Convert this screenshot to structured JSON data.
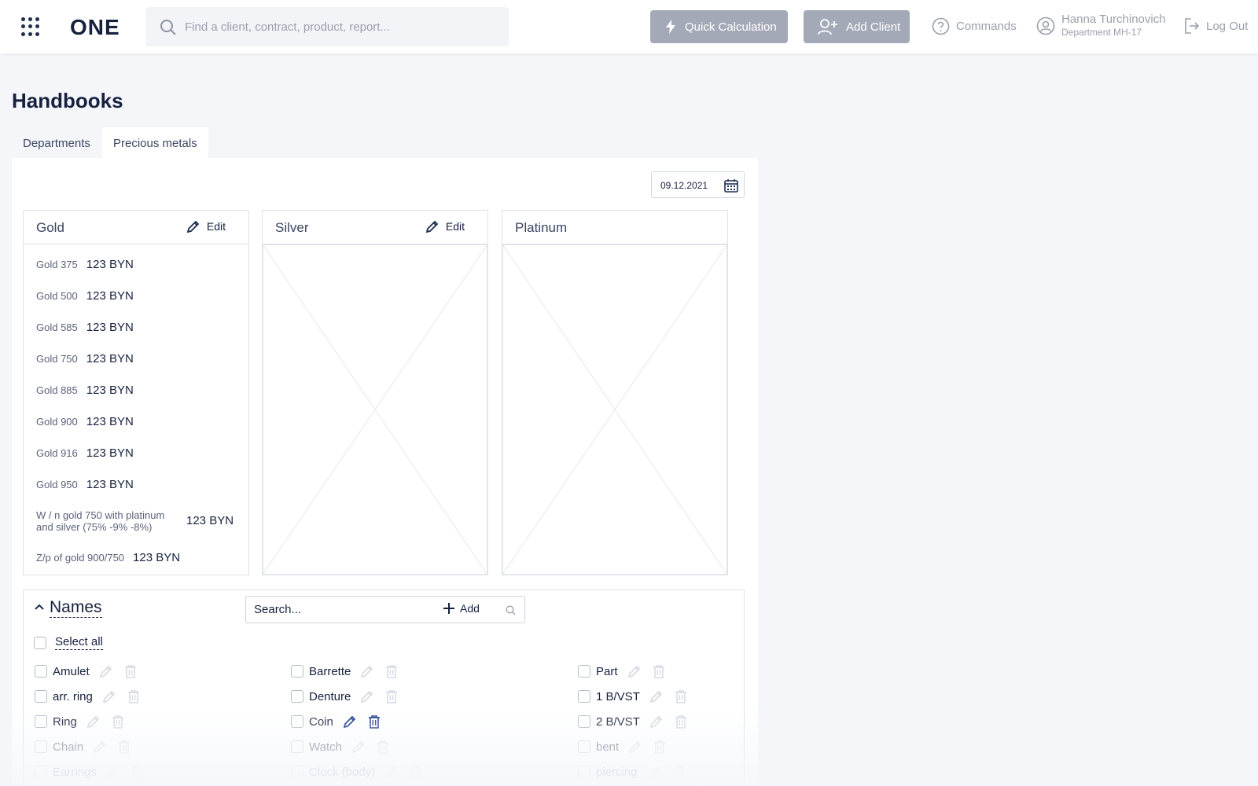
{
  "app": {
    "logo": "ONE"
  },
  "header": {
    "search_placeholder": "Find a client, contract, product, report...",
    "quick_calc_label": "Quick Calculation",
    "add_client_label": "Add Client",
    "commands_label": "Commands",
    "user_name": "Hanna Turchinovich",
    "user_department": "Department MH-17",
    "logout_label": "Log Out"
  },
  "page": {
    "title": "Handbooks",
    "tabs": [
      {
        "label": "Departments",
        "active": false
      },
      {
        "label": "Precious metals",
        "active": true
      }
    ],
    "date": "09.12.2021"
  },
  "metals": {
    "edit_label": "Edit",
    "gold": {
      "title": "Gold",
      "rows": [
        {
          "label": "Gold 375",
          "value": "123 BYN"
        },
        {
          "label": "Gold 500",
          "value": "123 BYN"
        },
        {
          "label": "Gold 585",
          "value": "123 BYN"
        },
        {
          "label": "Gold 750",
          "value": "123 BYN"
        },
        {
          "label": "Gold 885",
          "value": "123 BYN"
        },
        {
          "label": "Gold 900",
          "value": "123 BYN"
        },
        {
          "label": "Gold 916",
          "value": "123 BYN"
        },
        {
          "label": "Gold 950",
          "value": "123 BYN"
        },
        {
          "label": "W / n gold 750 with platinum and silver (75% -9% -8%)",
          "value": "123 BYN"
        },
        {
          "label": "Z/p of gold 900/750",
          "value": "123 BYN"
        }
      ]
    },
    "silver": {
      "title": "Silver"
    },
    "platinum": {
      "title": "Platinum"
    }
  },
  "names": {
    "title": "Names",
    "search_placeholder": "Search...",
    "add_label": "Add",
    "select_all_label": "Select all",
    "items": [
      [
        "Amulet",
        "Barrette",
        "Part"
      ],
      [
        "arr. ring",
        "Denture",
        "1 B/VST"
      ],
      [
        "Ring",
        "Coin",
        "2 B/VST"
      ],
      [
        "Chain",
        "Watch",
        "bent"
      ],
      [
        "Earrings",
        "Clock (body)",
        "piercing"
      ]
    ]
  },
  "colors": {
    "accent": "#1f3c88",
    "button_disabled": "#a4a9b8",
    "text": "#16213e"
  }
}
